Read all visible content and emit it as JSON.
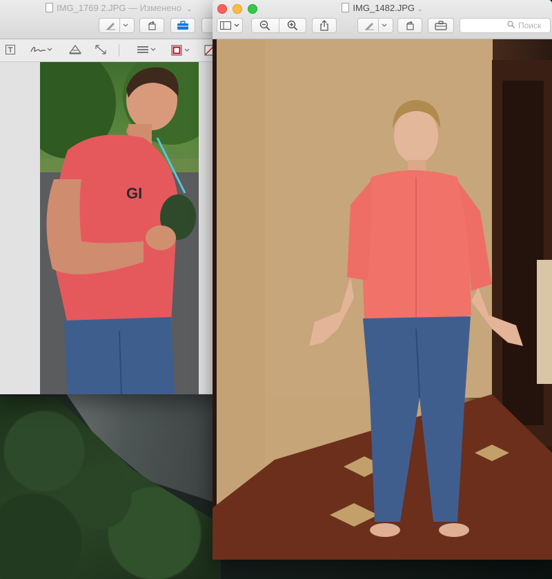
{
  "back_window": {
    "title": "IMG_1769 2.JPG",
    "title_suffix": "— Изменено",
    "title_chevron": "⌄"
  },
  "front_window": {
    "title": "IMG_1482.JPG",
    "title_chevron": "⌄",
    "search": {
      "placeholder": "Поиск"
    }
  },
  "colors": {
    "shirt_pink": "#f26d6d",
    "jeans": "#3d5c8c",
    "close": "#fc605c",
    "minimize": "#fdbc40",
    "maximize": "#34c84a"
  }
}
